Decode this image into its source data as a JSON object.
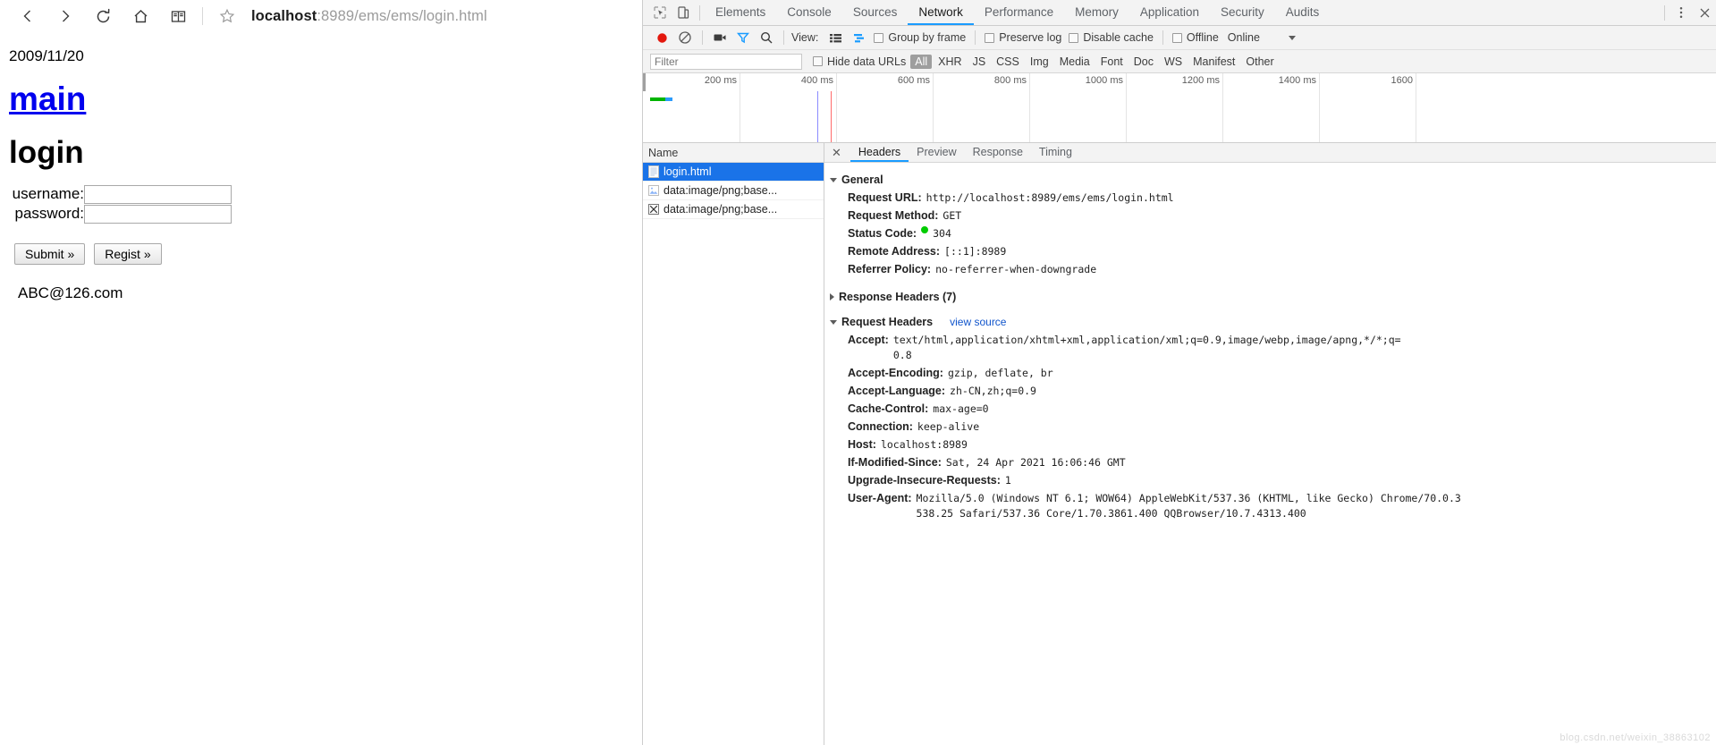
{
  "browser": {
    "nav_icons": [
      {
        "name": "back-icon",
        "label": "Back"
      },
      {
        "name": "forward-icon",
        "label": "Forward"
      },
      {
        "name": "reload-icon",
        "label": "Reload"
      },
      {
        "name": "home-icon",
        "label": "Home"
      },
      {
        "name": "reader-icon",
        "label": "Reader"
      }
    ],
    "bookmark_icon": "star-icon",
    "url_host": "localhost",
    "url_rest": ":8989/ems/ems/login.html",
    "url_full": "localhost:8989/ems/ems/login.html",
    "right_icons": [
      {
        "name": "lightning-icon"
      },
      {
        "name": "chevron-down-icon"
      },
      {
        "name": "bird-extension-icon"
      },
      {
        "name": "gamepad-extension-icon"
      },
      {
        "name": "moon-icon"
      },
      {
        "name": "history-back-icon"
      },
      {
        "name": "more-icon"
      },
      {
        "name": "menu-icon"
      }
    ]
  },
  "page": {
    "date": "2009/11/20",
    "main_link": "main",
    "heading": "login",
    "fields": [
      {
        "label": "username:",
        "value": "",
        "placeholder": "",
        "name": "username-field"
      },
      {
        "label": "password:",
        "value": "",
        "placeholder": "",
        "name": "password-field"
      }
    ],
    "buttons": [
      {
        "label": "Submit »",
        "name": "submit-button"
      },
      {
        "label": "Regist »",
        "name": "regist-button"
      }
    ],
    "email": "ABC@126.com"
  },
  "devtools": {
    "tabs": [
      {
        "label": "Elements",
        "active": false
      },
      {
        "label": "Console",
        "active": false
      },
      {
        "label": "Sources",
        "active": false
      },
      {
        "label": "Network",
        "active": true
      },
      {
        "label": "Performance",
        "active": false
      },
      {
        "label": "Memory",
        "active": false
      },
      {
        "label": "Application",
        "active": false
      },
      {
        "label": "Security",
        "active": false
      },
      {
        "label": "Audits",
        "active": false
      }
    ],
    "network_toolbar": {
      "view_label": "View:",
      "checkboxes": [
        {
          "label": "Group by frame",
          "checked": false
        },
        {
          "label": "Preserve log",
          "checked": false
        },
        {
          "label": "Disable cache",
          "checked": false
        },
        {
          "label": "Offline",
          "checked": false
        }
      ],
      "throttle_value": "Online"
    },
    "filter_bar": {
      "filter_placeholder": "Filter",
      "filter_value": "",
      "hide_data_urls_label": "Hide data URLs",
      "hide_data_urls_checked": false,
      "types": [
        {
          "label": "All",
          "active": true
        },
        {
          "label": "XHR",
          "active": false
        },
        {
          "label": "JS",
          "active": false
        },
        {
          "label": "CSS",
          "active": false
        },
        {
          "label": "Img",
          "active": false
        },
        {
          "label": "Media",
          "active": false
        },
        {
          "label": "Font",
          "active": false
        },
        {
          "label": "Doc",
          "active": false
        },
        {
          "label": "WS",
          "active": false
        },
        {
          "label": "Manifest",
          "active": false
        },
        {
          "label": "Other",
          "active": false
        }
      ]
    },
    "timeline": {
      "ticks": [
        "200 ms",
        "400 ms",
        "600 ms",
        "800 ms",
        "1000 ms",
        "1200 ms",
        "1400 ms",
        "1600"
      ]
    },
    "request_list": {
      "column_header": "Name",
      "rows": [
        {
          "name": "login.html",
          "icon": "document-icon",
          "selected": true
        },
        {
          "name": "data:image/png;base...",
          "icon": "image-icon",
          "selected": false
        },
        {
          "name": "data:image/png;base...",
          "icon": "broken-image-icon",
          "selected": false
        }
      ]
    },
    "detail": {
      "tabs": [
        {
          "label": "Headers",
          "active": true
        },
        {
          "label": "Preview",
          "active": false
        },
        {
          "label": "Response",
          "active": false
        },
        {
          "label": "Timing",
          "active": false
        }
      ],
      "sections": [
        {
          "title": "General",
          "expanded": true,
          "view_source": "",
          "items": [
            {
              "key": "Request URL:",
              "value": "http://localhost:8989/ems/ems/login.html"
            },
            {
              "key": "Request Method:",
              "value": "GET"
            },
            {
              "key": "Status Code:",
              "value": "304",
              "status_dot": "#00c000"
            },
            {
              "key": "Remote Address:",
              "value": "[::1]:8989"
            },
            {
              "key": "Referrer Policy:",
              "value": "no-referrer-when-downgrade"
            }
          ]
        },
        {
          "title": "Response Headers (7)",
          "expanded": false,
          "view_source": "",
          "items": []
        },
        {
          "title": "Request Headers",
          "expanded": true,
          "view_source": "view source",
          "items": [
            {
              "key": "Accept:",
              "value": "text/html,application/xhtml+xml,application/xml;q=0.9,image/webp,image/apng,*/*;q=0.8"
            },
            {
              "key": "Accept-Encoding:",
              "value": "gzip, deflate, br"
            },
            {
              "key": "Accept-Language:",
              "value": "zh-CN,zh;q=0.9"
            },
            {
              "key": "Cache-Control:",
              "value": "max-age=0"
            },
            {
              "key": "Connection:",
              "value": "keep-alive"
            },
            {
              "key": "Host:",
              "value": "localhost:8989"
            },
            {
              "key": "If-Modified-Since:",
              "value": "Sat, 24 Apr 2021 16:06:46 GMT"
            },
            {
              "key": "Upgrade-Insecure-Requests:",
              "value": "1"
            },
            {
              "key": "User-Agent:",
              "value": "Mozilla/5.0 (Windows NT 6.1; WOW64) AppleWebKit/537.36 (KHTML, like Gecko) Chrome/70.0.3538.25 Safari/537.36 Core/1.70.3861.400 QQBrowser/10.7.4313.400"
            }
          ]
        }
      ]
    },
    "close_icon": "close-icon",
    "more_icon": "more-vertical-icon"
  },
  "watermark": "blog.csdn.net/weixin_38863102"
}
